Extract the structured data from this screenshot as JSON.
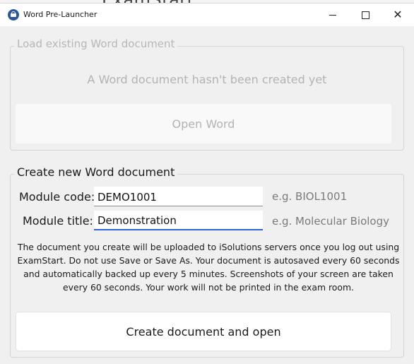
{
  "background_app_title": "ExamStart",
  "window": {
    "title": "Word Pre-Launcher",
    "minimize_glyph": "—",
    "maximize_glyph": "☐",
    "close_glyph": "✕"
  },
  "load_section": {
    "legend": "Load existing Word document",
    "status": "A Word document hasn't been created yet",
    "open_button": "Open Word",
    "state": "disabled"
  },
  "create_section": {
    "legend": "Create new Word document",
    "module_code": {
      "label": "Module code:",
      "value": "DEMO1001",
      "hint": "e.g. BIOL1001"
    },
    "module_title": {
      "label": "Module title:",
      "value": "Demonstration",
      "hint": "e.g. Molecular Biology",
      "focused": true
    },
    "notice": "The document you create will be uploaded to iSolutions servers once you log out using ExamStart. Do not use Save or Save As. Your document is autosaved every 60 seconds and automatically backed up every 5 minutes. Screenshots of your screen are taken every 60 seconds. Your work will not be printed in the exam room.",
    "create_button": "Create document and open"
  },
  "colors": {
    "accent": "#2f64d8",
    "app_icon": "#2b5797",
    "disabled_text": "#b3b3b3",
    "hint_text": "#7a7a7a"
  },
  "icons": {
    "app": "word-launcher-icon",
    "minimize": "minimize-icon",
    "maximize": "maximize-icon",
    "close": "close-icon"
  }
}
